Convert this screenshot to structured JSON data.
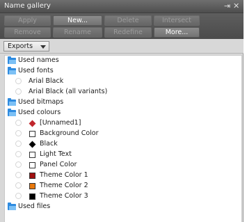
{
  "window": {
    "title": "Name gallery"
  },
  "toolbar": {
    "apply": "Apply",
    "new": "New...",
    "delete": "Delete",
    "intersect": "Intersect",
    "remove": "Remove",
    "rename": "Rename",
    "redefine": "Redefine",
    "more": "More..."
  },
  "filter": {
    "selected": "Exports"
  },
  "tree": {
    "used_names": "Used names",
    "used_fonts": {
      "label": "Used fonts",
      "items": [
        "Arial Black",
        "Arial Black (all variants)"
      ]
    },
    "used_bitmaps": "Used bitmaps",
    "used_colours": {
      "label": "Used colours",
      "items": [
        {
          "label": "[Unnamed1]",
          "color": "#c0272d"
        },
        {
          "label": "Background Color",
          "color": "#ffffff"
        },
        {
          "label": "Black",
          "color": "#000000"
        },
        {
          "label": "Light Text",
          "color": "#ffffff"
        },
        {
          "label": "Panel Color",
          "color": "#ffffff"
        },
        {
          "label": "Theme Color 1",
          "color": "#a01010"
        },
        {
          "label": "Theme Color 2",
          "color": "#e8780c"
        },
        {
          "label": "Theme Color 3",
          "color": "#000000"
        }
      ]
    },
    "used_files": "Used files"
  }
}
